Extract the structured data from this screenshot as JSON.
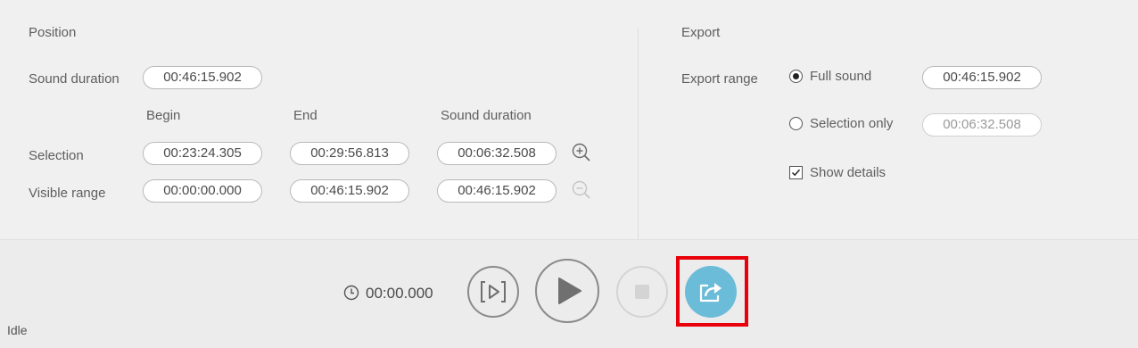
{
  "position": {
    "title": "Position",
    "sound_duration_label": "Sound duration",
    "sound_duration_value": "00:46:15.902",
    "columns": {
      "begin": "Begin",
      "end": "End",
      "duration": "Sound duration"
    },
    "selection": {
      "label": "Selection",
      "begin": "00:23:24.305",
      "end": "00:29:56.813",
      "duration": "00:06:32.508"
    },
    "visible_range": {
      "label": "Visible range",
      "begin": "00:00:00.000",
      "end": "00:46:15.902",
      "duration": "00:46:15.902"
    }
  },
  "export": {
    "title": "Export",
    "range_label": "Export range",
    "full_sound_label": "Full sound",
    "full_sound_value": "00:46:15.902",
    "selection_only_label": "Selection only",
    "selection_only_value": "00:06:32.508",
    "show_details_label": "Show details",
    "selected_option": "Full sound",
    "show_details_checked": true
  },
  "playback": {
    "time": "00:00.000",
    "accent": "#6bbcd8"
  },
  "status": "Idle",
  "icons": {
    "zoom_in": "zoom-in-icon",
    "zoom_out": "zoom-out-icon",
    "clock": "clock-icon",
    "play_selection": "play-selection-icon",
    "play": "play-icon",
    "stop": "stop-icon",
    "export": "export-icon"
  }
}
